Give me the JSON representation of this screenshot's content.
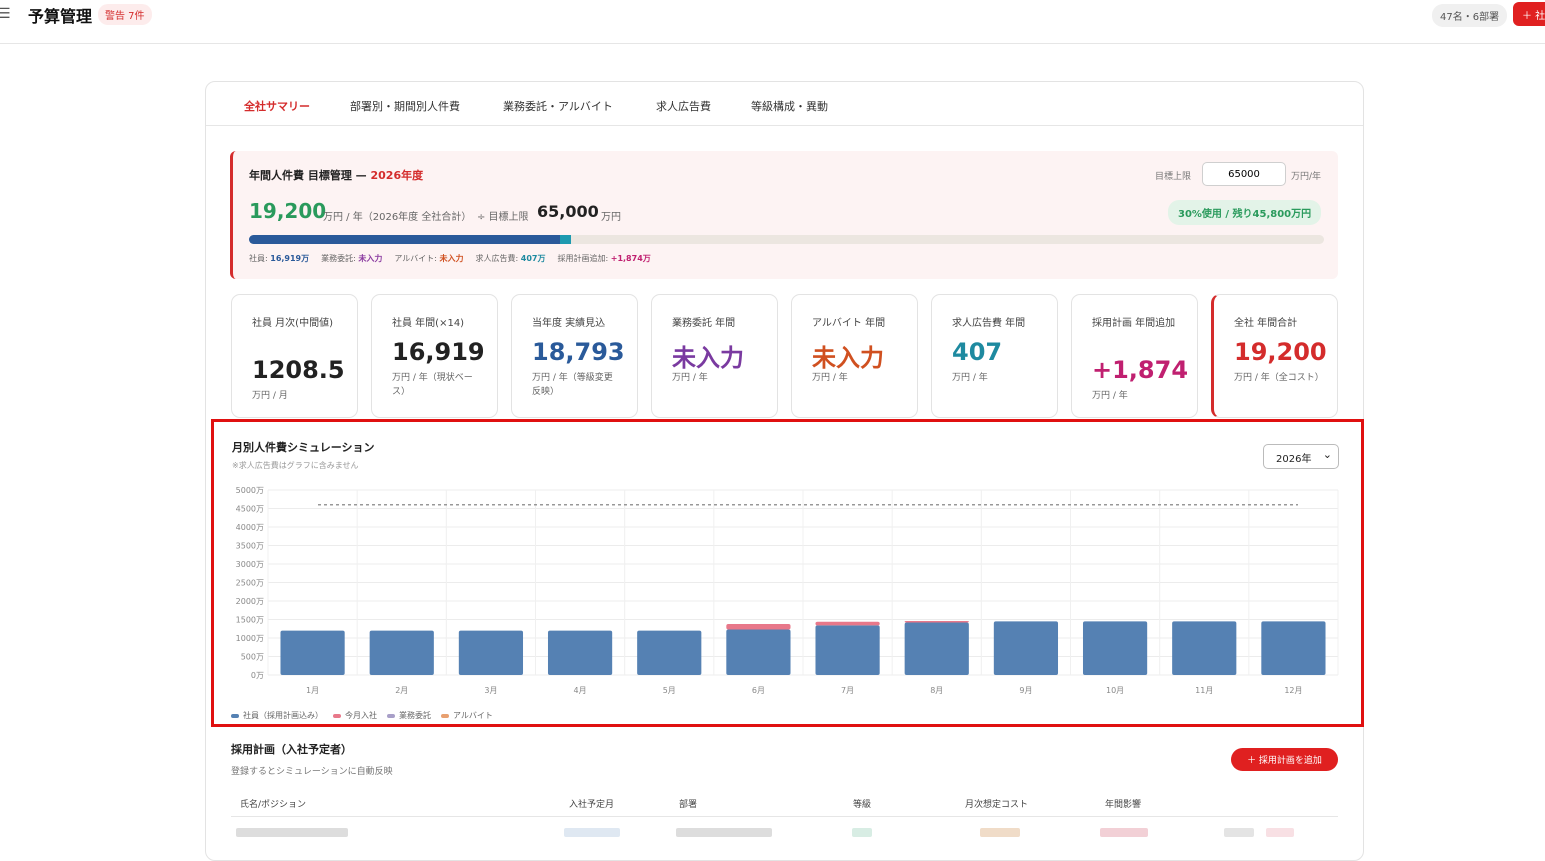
{
  "header": {
    "menu_icon": "hamburger-icon",
    "title": "予算管理",
    "warning_badge": "警告 7件",
    "staff_summary": "47名・6部署",
    "add_button": "＋ 社"
  },
  "tabs": [
    {
      "label": "全社サマリー",
      "active": true
    },
    {
      "label": "部署別・期間別人件費",
      "active": false
    },
    {
      "label": "業務委託・アルバイト",
      "active": false
    },
    {
      "label": "求人広告費",
      "active": false
    },
    {
      "label": "等級構成・異動",
      "active": false
    }
  ],
  "target": {
    "title_prefix": "年間人件費 目標管理 — ",
    "title_year": "2026年度",
    "limit_label": "目標上限",
    "limit_value": "65000",
    "limit_unit": "万円/年",
    "total": "19,200",
    "total_unit": "万円 / 年（2026年度 全社合計）",
    "plus_label": "÷ 目標上限",
    "goal": "65,000",
    "goal_unit": "万円",
    "usage_badge": "30%使用 / 残り45,800万円",
    "usage_fraction": 0.3,
    "breakdown": [
      {
        "label": "社員: ",
        "value": "16,919万",
        "color": "#2a5a9a"
      },
      {
        "label": "業務委託: ",
        "value": "未入力",
        "color": "#8a3aa0"
      },
      {
        "label": "アルバイト: ",
        "value": "未入力",
        "color": "#d05020"
      },
      {
        "label": "求人広告費: ",
        "value": "407万",
        "color": "#1e8aa0"
      },
      {
        "label": "採用計画追加: ",
        "value": "+1,874万",
        "color": "#c02070"
      }
    ]
  },
  "kpis": [
    {
      "label": "社員 月次(中間値)",
      "value": "1208.5",
      "unit": "万円 / 月",
      "color": "#222222"
    },
    {
      "label": "社員 年間(×14)",
      "value": "16,919",
      "unit": "万円 / 年（現状ベース）",
      "color": "#222222"
    },
    {
      "label": "当年度 実績見込",
      "value": "18,793",
      "unit": "万円 / 年（等級変更反映）",
      "color": "#2a5a9a"
    },
    {
      "label": "業務委託 年間",
      "value": "未入力",
      "unit": "万円 / 年",
      "color": "#7a3aa0"
    },
    {
      "label": "アルバイト 年間",
      "value": "未入力",
      "unit": "万円 / 年",
      "color": "#d05020"
    },
    {
      "label": "求人広告費 年間",
      "value": "407",
      "unit": "万円 / 年",
      "color": "#1e8aa0"
    },
    {
      "label": "採用計画 年間追加",
      "value": "+1,874",
      "unit": "万円 / 年",
      "color": "#c02070"
    },
    {
      "label": "全社 年間合計",
      "value": "19,200",
      "unit": "万円 / 年（全コスト）",
      "color": "#d42c2c"
    }
  ],
  "chart_section": {
    "title": "月別人件費シミュレーション",
    "note": "※求人広告費はグラフに含みません",
    "year_select": "2026年"
  },
  "chart_data": {
    "type": "bar",
    "stacked": true,
    "categories": [
      "1月",
      "2月",
      "3月",
      "4月",
      "5月",
      "6月",
      "7月",
      "8月",
      "9月",
      "10月",
      "11月",
      "12月"
    ],
    "y_tick_labels": [
      "0万",
      "500万",
      "1000万",
      "1500万",
      "2000万",
      "2500万",
      "3000万",
      "3500万",
      "4000万",
      "4500万",
      "5000万"
    ],
    "ylim": [
      0,
      5000
    ],
    "target_line": 4600,
    "series": [
      {
        "name": "社員（採用計画込み）",
        "color": "#5581b3",
        "values": [
          1200,
          1200,
          1200,
          1200,
          1200,
          1230,
          1340,
          1420,
          1450,
          1450,
          1450,
          1450
        ]
      },
      {
        "name": "今月入社",
        "color": "#e8788a",
        "values": [
          0,
          0,
          0,
          0,
          0,
          150,
          100,
          40,
          0,
          0,
          0,
          0
        ]
      },
      {
        "name": "業務委託",
        "color": "#a89fc8",
        "values": [
          0,
          0,
          0,
          0,
          0,
          0,
          0,
          0,
          0,
          0,
          0,
          0
        ]
      },
      {
        "name": "アルバイト",
        "color": "#e8a070",
        "values": [
          0,
          0,
          0,
          0,
          0,
          0,
          0,
          0,
          0,
          0,
          0,
          0
        ]
      }
    ],
    "grid": true,
    "legend_position": "bottom-left"
  },
  "plan": {
    "title": "採用計画（入社予定者）",
    "subtitle": "登録するとシミュレーションに自動反映",
    "add_button": "＋ 採用計画を追加",
    "columns": [
      "氏名/ポジション",
      "入社予定月",
      "部署",
      "等級",
      "月次想定コスト",
      "年間影響"
    ]
  }
}
